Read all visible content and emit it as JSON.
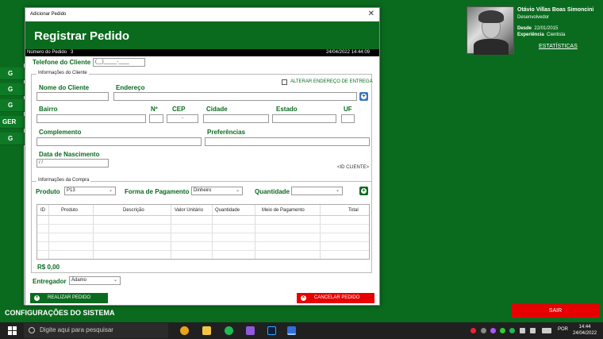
{
  "app": {
    "profile": {
      "name": "Otávio Villas Boas Simoncini",
      "role": "Desenvolvedor",
      "since_label": "Desde",
      "since_value": "22/01/2015",
      "experience_label": "Experiência",
      "experience_value": "Cientista",
      "stats_link": "ESTATÍSTICAS"
    },
    "side_tabs": [
      "G",
      "G",
      "G",
      "GER",
      "G"
    ],
    "config_label": "CONFIGURAÇÕES DO SISTEMA",
    "exit_button": "SAIR"
  },
  "dialog": {
    "window_title": "Adicionar Pedido",
    "close_glyph": "✕",
    "heading": "Registrar Pedido",
    "order_number_label": "Número do Pedido",
    "order_number": "3",
    "datetime": "24/04/2022 14:44:09",
    "phone_label": "Telefone do Cliente",
    "phone_mask": "(__)_____-____",
    "client_group": {
      "title": "Informações do Cliente",
      "alter_address_label": "ALTERAR ENDEREÇO DE ENTREGA",
      "name_label": "Nome do Cliente",
      "address_label": "Endereço",
      "district_label": "Bairro",
      "number_label": "Nº",
      "cep_label": "CEP",
      "cep_mask": "-",
      "city_label": "Cidade",
      "state_label": "Estado",
      "uf_label": "UF",
      "complement_label": "Complemento",
      "preferences_label": "Preferências",
      "birth_label": "Data de Nascimento",
      "birth_mask": "/ /",
      "client_id": "<ID CLIENTE>"
    },
    "purchase_group": {
      "title": "Informações da Compra",
      "product_label": "Produto",
      "product_value": "P13",
      "payment_label": "Forma de Pagamento",
      "payment_value": "Dinheiro",
      "quantity_label": "Quantidade",
      "quantity_value": "",
      "columns": [
        "ID",
        "Produto",
        "Descrição",
        "Valor Unitário",
        "Quantidade",
        "Meio de Pagamento",
        "Total"
      ],
      "total": "R$ 0,00"
    },
    "deliverer_label": "Entregador",
    "deliverer_value": "Ádamo",
    "confirm_button": "REALIZAR PEDIDO",
    "cancel_button": "CANCELAR PEDIDO"
  },
  "taskbar": {
    "search_placeholder": "Digite aqui para pesquisar",
    "lang": "POR",
    "time": "14:44",
    "date": "24/04/2022"
  },
  "colors": {
    "brand_green": "#0a6b1e",
    "danger_red": "#e60000",
    "plus_blue": "#3a78c2"
  }
}
